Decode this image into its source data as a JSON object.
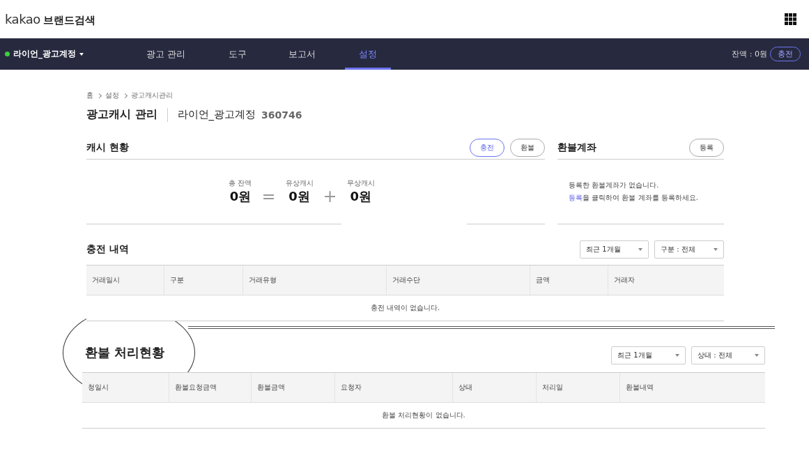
{
  "header": {
    "logo": "kakao",
    "product": "브랜드검색"
  },
  "nav": {
    "account": "라이언_광고계정",
    "tabs": [
      {
        "label": "광고 관리",
        "selected": false
      },
      {
        "label": "도구",
        "selected": false
      },
      {
        "label": "보고서",
        "selected": false
      },
      {
        "label": "설정",
        "selected": true
      }
    ],
    "balance": "잔액 : 0원",
    "charge_button": "충전"
  },
  "breadcrumb": [
    "홈",
    "설정",
    "광고캐시관리"
  ],
  "page_title": "광고캐시 관리",
  "account_name": "라이언_광고계정",
  "account_id": "360746",
  "cash_status": {
    "title": "캐시 현황",
    "buttons": [
      {
        "label": "충전",
        "primary": true
      },
      {
        "label": "환불",
        "primary": false
      }
    ],
    "summary": [
      {
        "kind": "amount",
        "label": "총 잔액",
        "value": "0원"
      },
      {
        "kind": "operator",
        "symbol": "="
      },
      {
        "kind": "amount",
        "label": "유상캐시",
        "value": "0원"
      },
      {
        "kind": "operator",
        "symbol": "+"
      },
      {
        "kind": "amount",
        "label": "무상캐시",
        "value": "0원"
      }
    ]
  },
  "refund_account": {
    "title": "환불계좌",
    "button": "등록",
    "message": "등록한 환불계좌가 없습니다.",
    "link": "등록",
    "hint": "을 클릭하여 환불 계좌를 등록하세요."
  },
  "charge_history": {
    "title": "충전 내역",
    "filters": [
      "최근 1개월",
      "구분 : 전체"
    ],
    "columns": [
      "거래일시",
      "구분",
      "거래유형",
      "거래수단",
      "금액",
      "거래자"
    ],
    "empty": "충전 내역이 없습니다."
  },
  "refund_status": {
    "title": "환불 처리현황",
    "filters": [
      "최근 1개월",
      "상태 : 전체"
    ],
    "columns": [
      "청일시",
      "환불요청금액",
      "환불금액",
      "요청자",
      "상태",
      "처리일",
      "환불내역"
    ],
    "empty": "환불 처리현황이 없습니다."
  }
}
